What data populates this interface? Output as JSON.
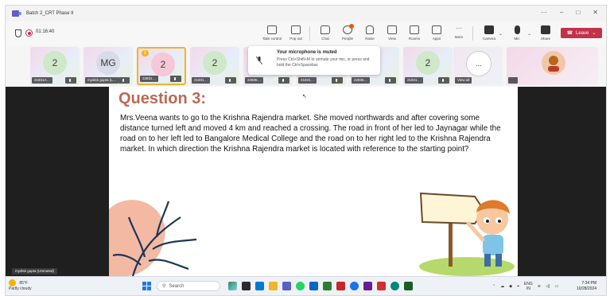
{
  "window": {
    "title": "Batch 2_CRT Phase II",
    "controls": [
      "⋯",
      "–",
      "□",
      "✕"
    ]
  },
  "meeting": {
    "elapsed_time": "01:16:40"
  },
  "toolbar": {
    "take_control": "Take control",
    "pop_out": "Pop out",
    "chat": "Chat",
    "people": "People",
    "people_count": "",
    "raise": "Raise",
    "view": "View",
    "rooms": "Rooms",
    "apps": "Apps",
    "more": "More",
    "camera": "Camera",
    "mic": "Mic",
    "share": "Share",
    "leave": "Leave"
  },
  "participants": [
    {
      "initials": "2",
      "name": "21831A…",
      "color": "#cfe8c8"
    },
    {
      "initials": "MG",
      "name": "mydisk gupta (L…",
      "color": "#d8dbe8"
    },
    {
      "initials": "2",
      "name": "22831…",
      "color": "#f6c7d6",
      "hand": "1"
    },
    {
      "initials": "2",
      "name": "21831…",
      "color": "#cfe8c8"
    },
    {
      "initials": "",
      "name": "22835…",
      "color": "#cfe8c8"
    },
    {
      "initials": "",
      "name": "21831…",
      "color": "#cfe8c8"
    },
    {
      "initials": "",
      "name": "22835…",
      "color": "#cfe8c8"
    },
    {
      "initials": "2",
      "name": "21831…",
      "color": "#cfe8c8"
    },
    {
      "initials": "...",
      "name": "View all",
      "color": "#ffffff"
    },
    {
      "initials": "",
      "name": "",
      "color": "#f0c8a8"
    }
  ],
  "toast": {
    "title": "Your microphone is muted",
    "body": "Press Ctrl+Shift+M to unmute your mic, or press and hold the Ctrl+Spacebar."
  },
  "slide": {
    "title": "Question 3:",
    "body": "Mrs.Veena wants to go to the Krishna Rajendra market. She moved northwards and after covering some distance turned left and moved 4 km and reached a crossing. The road in front of her led to Jaynagar while the road on to her left led to Bangalore Medical College and the road on to her right led to the Krishna Rajendra market. In which direction the Krishna Rajendra market is located with reference to the starting point?"
  },
  "presenter_label": "mydisk gupta (Unmuted)",
  "taskbar": {
    "weather_temp": "85°F",
    "weather_desc": "Partly cloudy",
    "search_placeholder": "Search",
    "lang": "ENG",
    "region": "IN",
    "time": "7:34 PM",
    "date": "10/28/2024"
  },
  "colors": {
    "accent": "#5b5fc7",
    "leave": "#c4314b",
    "title": "#b86a55"
  }
}
